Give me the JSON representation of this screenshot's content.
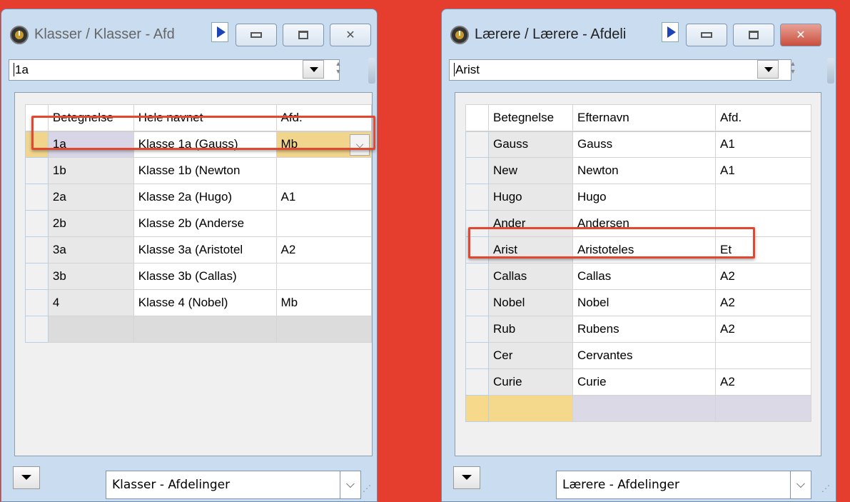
{
  "left_window": {
    "title": "Klasser / Klasser - Afd",
    "search_value": "1a",
    "columns": [
      "Betegnelse",
      "Hele navnet",
      "Afd."
    ],
    "rows": [
      {
        "code": "1a",
        "name": "Klasse 1a (Gauss)",
        "afd": "Mb"
      },
      {
        "code": "1b",
        "name": "Klasse 1b (Newton",
        "afd": ""
      },
      {
        "code": "2a",
        "name": "Klasse 2a (Hugo)",
        "afd": "A1"
      },
      {
        "code": "2b",
        "name": "Klasse 2b (Anderse",
        "afd": ""
      },
      {
        "code": "3a",
        "name": "Klasse 3a (Aristotel",
        "afd": "A2"
      },
      {
        "code": "3b",
        "name": "Klasse 3b (Callas)",
        "afd": ""
      },
      {
        "code": "4",
        "name": "Klasse 4 (Nobel)",
        "afd": "Mb"
      }
    ],
    "view_select": "Klasser - Afdelinger"
  },
  "right_window": {
    "title": "Lærere / Lærere - Afdeli",
    "search_value": "Arist",
    "columns": [
      "Betegnelse",
      "Efternavn",
      "Afd."
    ],
    "rows": [
      {
        "code": "Gauss",
        "name": "Gauss",
        "afd": "A1"
      },
      {
        "code": "New",
        "name": "Newton",
        "afd": "A1"
      },
      {
        "code": "Hugo",
        "name": "Hugo",
        "afd": ""
      },
      {
        "code": "Ander",
        "name": "Andersen",
        "afd": ""
      },
      {
        "code": "Arist",
        "name": "Aristoteles",
        "afd": "Et"
      },
      {
        "code": "Callas",
        "name": "Callas",
        "afd": "A2"
      },
      {
        "code": "Nobel",
        "name": "Nobel",
        "afd": "A2"
      },
      {
        "code": "Rub",
        "name": "Rubens",
        "afd": "A2"
      },
      {
        "code": "Cer",
        "name": "Cervantes",
        "afd": ""
      },
      {
        "code": "Curie",
        "name": "Curie",
        "afd": "A2"
      }
    ],
    "view_select": "Lærere - Afdelinger"
  },
  "colors": {
    "background": "#e53d2e",
    "highlight": "#e2482f",
    "current_row": "#f2d58c"
  },
  "glyphs": {
    "dropdown": "⌵",
    "close": "✕",
    "spin": "▲▼",
    "resize": "⋰"
  }
}
